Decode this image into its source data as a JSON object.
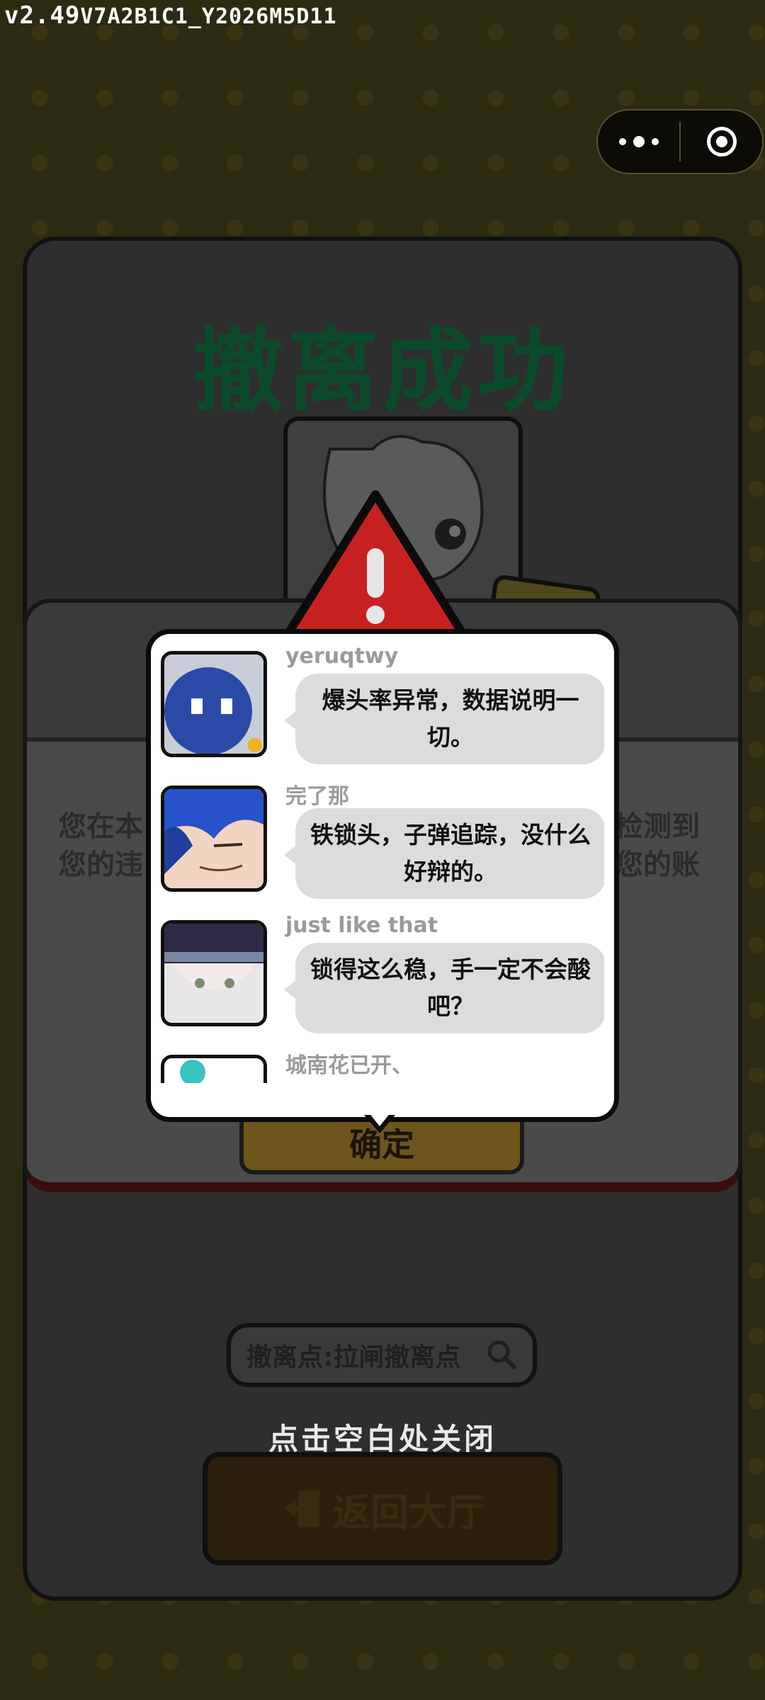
{
  "version": {
    "major": "v2.49",
    "build": "V7A2B1C1_Y2026M5D11"
  },
  "capsule": {
    "more_icon": "more-dots-icon",
    "close_icon": "target-close-icon"
  },
  "result": {
    "title": "撤离成功"
  },
  "warning": {
    "text_left_1": "您在本",
    "text_left_2": "您的违",
    "text_right_1": "检测到",
    "text_right_2": "您的账",
    "confirm_label": "确定"
  },
  "comments": [
    {
      "name": "yeruqtwy",
      "text": "爆头率异常，数据说明一切。"
    },
    {
      "name": "完了那",
      "text": "铁锁头，子弹追踪，没什么好辩的。"
    },
    {
      "name": "just like that",
      "text": "锁得这么稳，手一定不会酸吧？"
    },
    {
      "name": "城南花已开、",
      "text": ""
    }
  ],
  "search": {
    "label": "撤离点:拉闸撤离点"
  },
  "footer": {
    "close_hint": "点击空白处关闭",
    "lobby_label": "返回大厅"
  },
  "colors": {
    "accent_red": "#c62121",
    "title_green": "#0b4a2a",
    "bubble_gray": "#dcdcdc"
  }
}
